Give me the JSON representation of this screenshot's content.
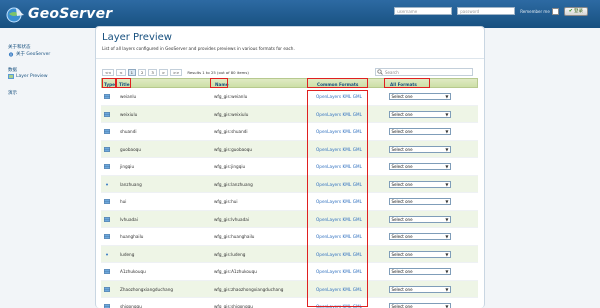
{
  "header": {
    "logo_text": "GeoServer",
    "username_placeholder": "username",
    "password_placeholder": "password",
    "remember_label": "Remember me",
    "login_label": "登录"
  },
  "sidebar": {
    "section_about": "关于和状态",
    "about_item": "关于 GeoServer",
    "section_data": "数据",
    "layer_preview_item": "Layer Preview",
    "section_demo": "演示"
  },
  "page": {
    "title": "Layer Preview",
    "description": "List of all layers configured in GeoServer and provides previews in various formats for each."
  },
  "pager": {
    "buttons": [
      "<<",
      "<",
      "1",
      "2",
      "3",
      ">",
      ">>"
    ],
    "current": "1",
    "results": "Results 1 to 25 (out of 80 items)"
  },
  "search": {
    "placeholder": "Search"
  },
  "table": {
    "headers": [
      "Type",
      "Title",
      "Name",
      "Common Formats",
      "All Formats"
    ],
    "formats": [
      "OpenLayers",
      "KML",
      "GML"
    ],
    "select_value": "Select one",
    "rows": [
      {
        "type": "polygon",
        "title": "weianlu",
        "name": "wfg_gis:weianlu"
      },
      {
        "type": "polygon",
        "title": "weixiulu",
        "name": "wfg_gis:weixiulu"
      },
      {
        "type": "polygon",
        "title": "shuandi",
        "name": "wfg_gis:shuandi"
      },
      {
        "type": "polygon",
        "title": "guobaoqu",
        "name": "wfg_gis:guobaoqu"
      },
      {
        "type": "polygon",
        "title": "jingqiu",
        "name": "wfg_gis:jingqiu"
      },
      {
        "type": "point",
        "title": "lanzhuang",
        "name": "wfg_gis:lanzhuang"
      },
      {
        "type": "polygon",
        "title": "hui",
        "name": "wfg_gis:hui"
      },
      {
        "type": "polygon",
        "title": "lvhuadai",
        "name": "wfg_gis:lvhuadai"
      },
      {
        "type": "polygon",
        "title": "huanghailu",
        "name": "wfg_gis:huanghailu"
      },
      {
        "type": "point",
        "title": "ludeng",
        "name": "wfg_gis:ludeng"
      },
      {
        "type": "polygon",
        "title": "A1zhukouqu",
        "name": "wfg_gis:A1zhukouqu"
      },
      {
        "type": "polygon",
        "title": "Zhaozhongxiangduchang",
        "name": "wfg_gis:zhaozhongxiangduchang"
      },
      {
        "type": "polygon",
        "title": "shigongqu",
        "name": "wfg_gis:shigongqu"
      }
    ]
  },
  "colors": {
    "header_bg": "#17507f",
    "accent": "#17507f",
    "link": "#2e6fbf",
    "row_alt": "#eef5e6",
    "annotation": "#e02020"
  }
}
